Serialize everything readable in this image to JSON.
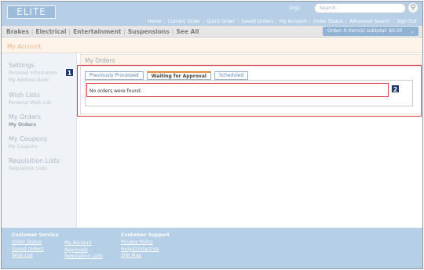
{
  "header": {
    "logo": "ELITE",
    "org": "Org1",
    "search_placeholder": "Search",
    "search_icon": "magnifier-icon",
    "nav": [
      "Home",
      "Current Order",
      "Quick Order",
      "Saved Orders",
      "My Account",
      "Order Status",
      "Advanced Search",
      "Sign Out"
    ]
  },
  "categories": [
    "Brakes",
    "Electrical",
    "Entertainment",
    "Suspensions",
    "See All"
  ],
  "cart": {
    "summary": "Order: 0 item(s) subtotal: $0.00",
    "chevron": "⌄"
  },
  "account_title": "My Account",
  "sidebar": {
    "sections": [
      {
        "heading": "Settings",
        "links": [
          "Personal Information",
          "My Address Book"
        ]
      },
      {
        "heading": "Wish Lists",
        "links": [
          "Personal Wish List"
        ]
      },
      {
        "heading": "My Orders",
        "links": [
          "My Orders"
        ]
      },
      {
        "heading": "My Coupons",
        "links": [
          "My Coupons"
        ]
      },
      {
        "heading": "Requisition Lists",
        "links": [
          "Requisition Lists"
        ]
      }
    ],
    "active_link": "My Orders"
  },
  "main": {
    "title": "My Orders",
    "tabs": [
      {
        "label": "Previously Processed",
        "active": false
      },
      {
        "label": "Waiting for Approval",
        "active": true
      },
      {
        "label": "Scheduled",
        "active": false
      }
    ],
    "message": "No orders were found."
  },
  "callouts": [
    "1",
    "2"
  ],
  "footer": {
    "columns": [
      {
        "heading": "Customer Service",
        "links": [
          "Order Status",
          "Saved Orders",
          "Wish List"
        ]
      },
      {
        "heading": "",
        "links": [
          "My Account",
          "Approvals",
          "Requisition Lists"
        ]
      },
      {
        "heading": "Customer Support",
        "links": [
          "Privacy Policy",
          "Help/Contact Us",
          "Site Map"
        ]
      }
    ]
  },
  "colors": {
    "header_bg": "#b7cfe6",
    "accent_tab": "#e88a3c",
    "highlight": "#e63b4a",
    "badge": "#1e3a6e"
  }
}
